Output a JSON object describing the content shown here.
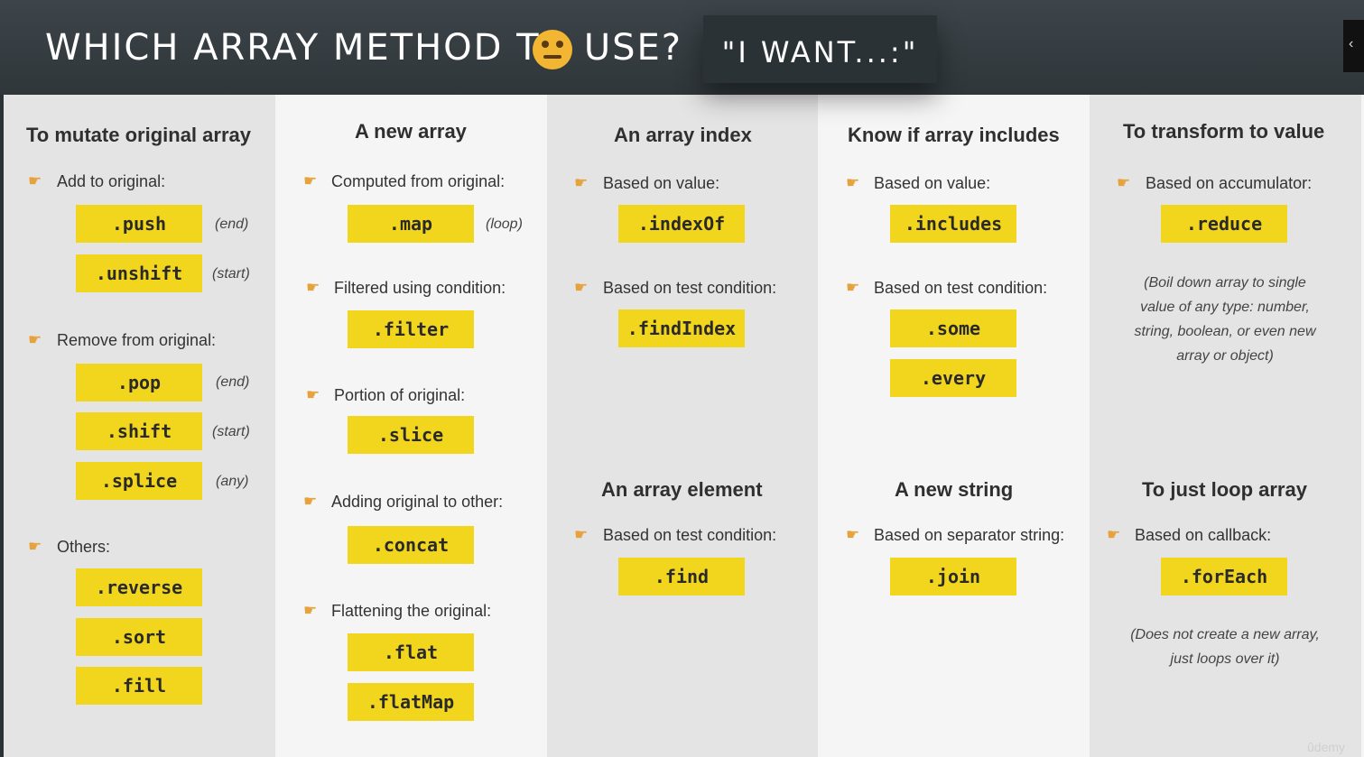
{
  "header": {
    "title": "WHICH ARRAY METHOD TO USE?",
    "title_emoji": "thinking-face-emoji",
    "i_want": "\"I WANT...:\""
  },
  "watermark": "ûdemy",
  "colors": {
    "method_box": "#f2d51d",
    "header_bg": "#353d41",
    "column_dark": "#e4e4e4",
    "column_light": "#f5f5f5",
    "hand_icon": "#e6a23c"
  },
  "columns": {
    "mutate": {
      "heading": "To mutate original array",
      "add_label": "Add to original:",
      "push": ".push",
      "push_note": "(end)",
      "unshift": ".unshift",
      "unshift_note": "(start)",
      "remove_label": "Remove from original:",
      "pop": ".pop",
      "pop_note": "(end)",
      "shift": ".shift",
      "shift_note": "(start)",
      "splice": ".splice",
      "splice_note": "(any)",
      "others_label": "Others:",
      "reverse": ".reverse",
      "sort": ".sort",
      "fill": ".fill"
    },
    "new_array": {
      "heading": "A new array",
      "computed_label": "Computed from original:",
      "map": ".map",
      "map_note": "(loop)",
      "filtered_label": "Filtered using condition:",
      "filter": ".filter",
      "portion_label": "Portion of original:",
      "slice": ".slice",
      "adding_label": "Adding original to other:",
      "concat": ".concat",
      "flattening_label": "Flattening the original:",
      "flat": ".flat",
      "flatMap": ".flatMap"
    },
    "index": {
      "heading": "An array index",
      "value_label": "Based on value:",
      "indexOf": ".indexOf",
      "test_label": "Based on test condition:",
      "findIndex": ".findIndex",
      "element_heading": "An array element",
      "element_test_label": "Based on test condition:",
      "find": ".find"
    },
    "includes": {
      "heading": "Know if array includes",
      "value_label": "Based on value:",
      "includes": ".includes",
      "test_label": "Based on test condition:",
      "some": ".some",
      "every": ".every",
      "string_heading": "A new string",
      "separator_label": "Based on separator string:",
      "join": ".join"
    },
    "transform": {
      "heading": "To transform to value",
      "accumulator_label": "Based on accumulator:",
      "reduce": ".reduce",
      "reduce_note_lines": [
        "(Boil down array to single",
        "value of any type: number,",
        "string, boolean, or even new",
        "array or object)"
      ],
      "loop_heading": "To just loop array",
      "callback_label": "Based on callback:",
      "forEach": ".forEach",
      "forEach_note_lines": [
        "(Does not create a new array,",
        "just loops over it)"
      ]
    }
  }
}
